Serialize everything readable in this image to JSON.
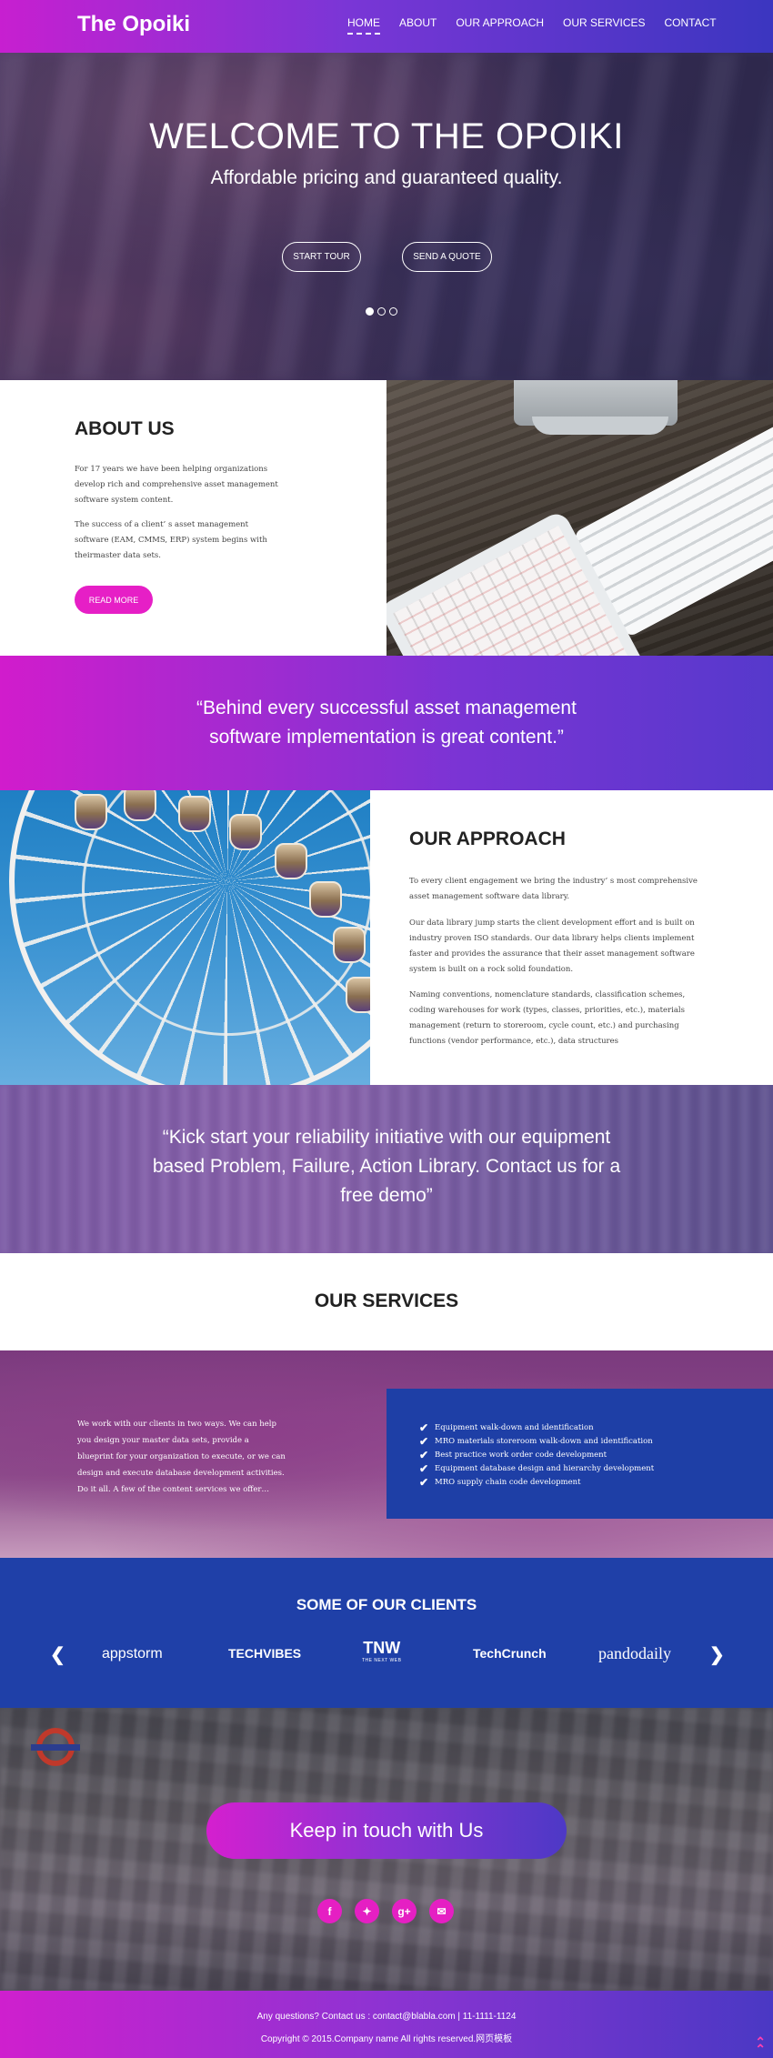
{
  "nav": {
    "brand": "The Opoiki",
    "links": [
      "HOME",
      "ABOUT",
      "OUR APPROACH",
      "OUR SERVICES",
      "CONTACT"
    ],
    "active": "HOME"
  },
  "hero": {
    "title": "WELCOME TO THE OPOIKI",
    "subtitle": "Affordable pricing and guaranteed quality.",
    "btn_tour": "START TOUR",
    "btn_quote": "SEND A QUOTE",
    "slides_total": 3,
    "slide_active": 1
  },
  "about": {
    "title": "ABOUT US",
    "p1": "For 17 years we have been helping organizations develop rich and comprehensive asset management software system content.",
    "p2": "The success of a client’ s asset management software (EAM, CMMS, ERP) system begins with theirmaster data sets.",
    "button": "READ MORE"
  },
  "quote1": "“Behind every successful asset management software implementation is great content.”",
  "approach": {
    "title": "OUR APPROACH",
    "p1": "To every client engagement we bring the industry’ s most comprehensive asset management software data library.",
    "p2": "Our data library jump starts the client development effort and is built on industry proven ISO standards. Our data library helps clients implement faster and provides the assurance that their asset management software system is built on a rock solid foundation.",
    "p3": "Naming conventions, nomenclature standards, classification schemes, coding warehouses for work (types, classes, priorities, etc.), materials management (return to storeroom, cycle count, etc.) and purchasing functions (vendor performance, etc.), data structures"
  },
  "quote2": "“Kick start your reliability initiative with our equipment based Problem, Failure, Action Library. Contact us for a free demo”",
  "services": {
    "title": "OUR SERVICES",
    "intro": "We work with our clients in two ways. We can help you design your master data sets, provide a blueprint for your organization to execute, or we can design and execute database development activities. Do it all. A few of the content services we offer…",
    "items": [
      "Equipment walk-down and identification",
      "MRO materials storeroom walk-down and identification",
      "Best practice work order code development",
      "Equipment database design and hierarchy development",
      "MRO supply chain code development"
    ]
  },
  "clients": {
    "title": "SOME OF OUR CLIENTS",
    "logos": [
      "appstorm",
      "TECHVIBES",
      "TNW",
      "TechCrunch",
      "pandodaily"
    ],
    "tnw_sub": "THE NEXT WEB"
  },
  "contact": {
    "button": "Keep in touch with Us",
    "socials": [
      "facebook",
      "twitter",
      "google-plus",
      "email"
    ]
  },
  "footer": {
    "line1": "Any questions? Contact us : contact@blabla.com | 11-1111-1124",
    "line2": "Copyright © 2015.Company name All rights reserved.网页模板"
  },
  "colors": {
    "magenta": "#e61fc6",
    "violet": "#7a36d6",
    "blue": "#1f40a8"
  }
}
